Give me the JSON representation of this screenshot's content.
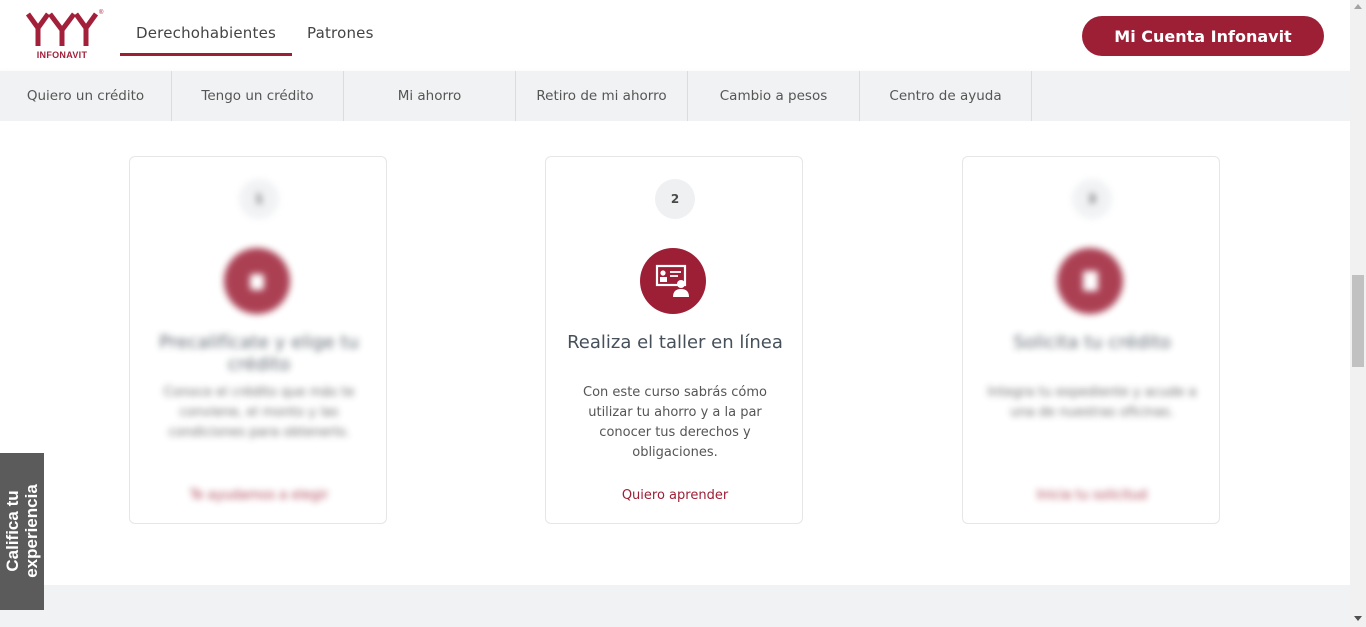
{
  "brand": {
    "logo_text": "INFONAVIT",
    "registered": "®",
    "accent": "#9d1f36"
  },
  "header": {
    "tabs": [
      {
        "label": "Derechohabientes",
        "active": true
      },
      {
        "label": "Patrones",
        "active": false
      }
    ],
    "cta_label": "Mi Cuenta Infonavit"
  },
  "subnav": {
    "items": [
      {
        "label": "Quiero un crédito"
      },
      {
        "label": "Tengo un crédito"
      },
      {
        "label": "Mi ahorro"
      },
      {
        "label": "Retiro de mi ahorro"
      },
      {
        "label": "Cambio a pesos"
      },
      {
        "label": "Centro de ayuda"
      }
    ]
  },
  "cards": [
    {
      "step": "1",
      "icon": "hand-icon",
      "title": "Precalifícate y elige tu crédito",
      "description": "Conoce el crédito que más te conviene, el monto y las condiciones para obtenerlo.",
      "link": "Te ayudamos a elegir",
      "blurred": true
    },
    {
      "step": "2",
      "icon": "online-class-icon",
      "title": "Realiza el taller en línea",
      "description": "Con este curso sabrás cómo utilizar tu ahorro y a la par conocer tus derechos y obligaciones.",
      "link": "Quiero aprender",
      "blurred": false
    },
    {
      "step": "3",
      "icon": "document-icon",
      "title": "Solicita tu crédito",
      "description": "Integra tu expediente y acude a una de nuestras oficinas.",
      "link": "Inicia tu solicitud",
      "blurred": true
    }
  ],
  "feedback": {
    "label": "Califica tu experiencia",
    "line1": "Califica tu",
    "line2": "experiencia"
  }
}
